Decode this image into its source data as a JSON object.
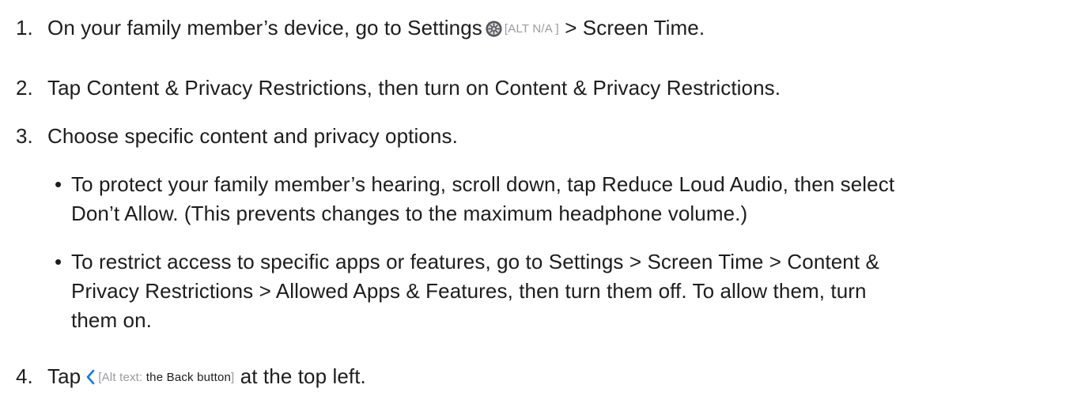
{
  "steps": [
    {
      "number": "1.",
      "before": "On your family member’s device, go to Settings",
      "icon": "settings-gear-icon",
      "alt": "[ALT N/A ]",
      "after": " > Screen Time."
    },
    {
      "number": "2.",
      "text": "Tap Content & Privacy Restrictions, then turn on Content & Privacy Restrictions."
    },
    {
      "number": "3.",
      "text": "Choose specific content and privacy options.",
      "bullets": [
        {
          "lines": [
            "To protect your family member’s hearing, scroll down, tap Reduce Loud Audio, then select",
            "Don’t Allow. (This prevents changes to the maximum headphone volume.)"
          ]
        },
        {
          "lines": [
            "To restrict access to specific apps or features, go to Settings > Screen Time > Content &",
            "Privacy Restrictions > Allowed Apps & Features, then turn them off. To allow them, turn",
            "them on."
          ]
        }
      ]
    },
    {
      "number": "4.",
      "before": "Tap",
      "icon": "back-chevron-icon",
      "alt_prefix": "[Alt text:",
      "alt_dark": " the Back button",
      "alt_suffix": "]",
      "after": " at the top left."
    }
  ],
  "colors": {
    "text": "#1d1d1f",
    "alt_text": "#9a9aa0",
    "chevron": "#0a7aff"
  }
}
